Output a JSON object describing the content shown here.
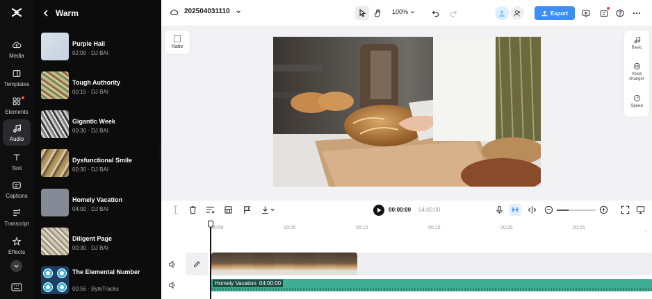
{
  "rail": {
    "items": [
      {
        "label": "Media",
        "icon": "cloud-upload-icon"
      },
      {
        "label": "Templates",
        "icon": "templates-icon"
      },
      {
        "label": "Elements",
        "icon": "elements-icon"
      },
      {
        "label": "Audio",
        "icon": "music-note-icon"
      },
      {
        "label": "Text",
        "icon": "text-icon"
      },
      {
        "label": "Captions",
        "icon": "captions-icon"
      },
      {
        "label": "Transcript",
        "icon": "transcript-icon"
      },
      {
        "label": "Effects",
        "icon": "effects-icon"
      }
    ]
  },
  "panel": {
    "title": "Warm",
    "tracks": [
      {
        "name": "Purple Hall",
        "meta": "02:00 · DJ BAI"
      },
      {
        "name": "Tough Authority",
        "meta": "00:15 · DJ BAI"
      },
      {
        "name": "Gigantic Week",
        "meta": "00:30 · DJ BAI"
      },
      {
        "name": "Dysfunctional Smile",
        "meta": "00:30 · DJ BAI"
      },
      {
        "name": "Homely Vacation",
        "meta": "04:00 · DJ BAI"
      },
      {
        "name": "Diligent Page",
        "meta": "00:30 · DJ BAI"
      },
      {
        "name": "The Elemental Number",
        "meta": "00:56 · ByteTracks"
      }
    ]
  },
  "topbar": {
    "project_name": "202504031110",
    "zoom": "100%",
    "export_label": "Export"
  },
  "canvas": {
    "ratio_label": "Ratio",
    "side_tools": [
      {
        "label": "Basic",
        "icon": "music-note-icon"
      },
      {
        "label": "Voice changer",
        "icon": "voice-changer-icon"
      },
      {
        "label": "Speed",
        "icon": "speed-icon"
      }
    ]
  },
  "timeline": {
    "current_time": "00:00:00",
    "total_time": "04:00:00",
    "ruler": [
      "00:00",
      "00:05",
      "00:10",
      "00:15",
      "00:20",
      "00:25"
    ],
    "audio_clip": {
      "name": "Homely Vacation",
      "duration": "04:00:00"
    }
  },
  "colors": {
    "accent": "#3b8ef5",
    "audio_clip": "#3fae93",
    "notification": "#ff3b3b"
  }
}
